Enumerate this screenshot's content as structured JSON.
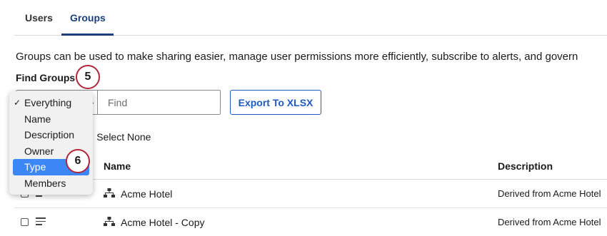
{
  "tabs": [
    {
      "label": "Users"
    },
    {
      "label": "Groups"
    }
  ],
  "intro_text": "Groups can be used to make sharing easier, manage user permissions more efficiently, subscribe to alerts, and govern",
  "find": {
    "label": "Find Groups",
    "placeholder": "Find",
    "export_label": "Export To XLSX"
  },
  "callouts": {
    "find_step": "5",
    "type_step": "6"
  },
  "select_links": "e | Select None",
  "dropdown": {
    "selected": "Everything",
    "highlighted": "Type",
    "options": [
      "Everything",
      "Name",
      "Description",
      "Owner",
      "Type",
      "Members"
    ]
  },
  "table": {
    "headers": {
      "name": "Name",
      "description": "Description"
    },
    "rows": [
      {
        "name": "Acme Hotel",
        "description": "Derived from Acme Hotel"
      },
      {
        "name": "Acme Hotel - Copy",
        "description": "Derived from Acme Hotel"
      }
    ]
  },
  "colors": {
    "accent": "#1d3f7a",
    "button": "#1d5ac2",
    "callout_ring": "#b3263a",
    "highlight": "#3d86f5"
  }
}
